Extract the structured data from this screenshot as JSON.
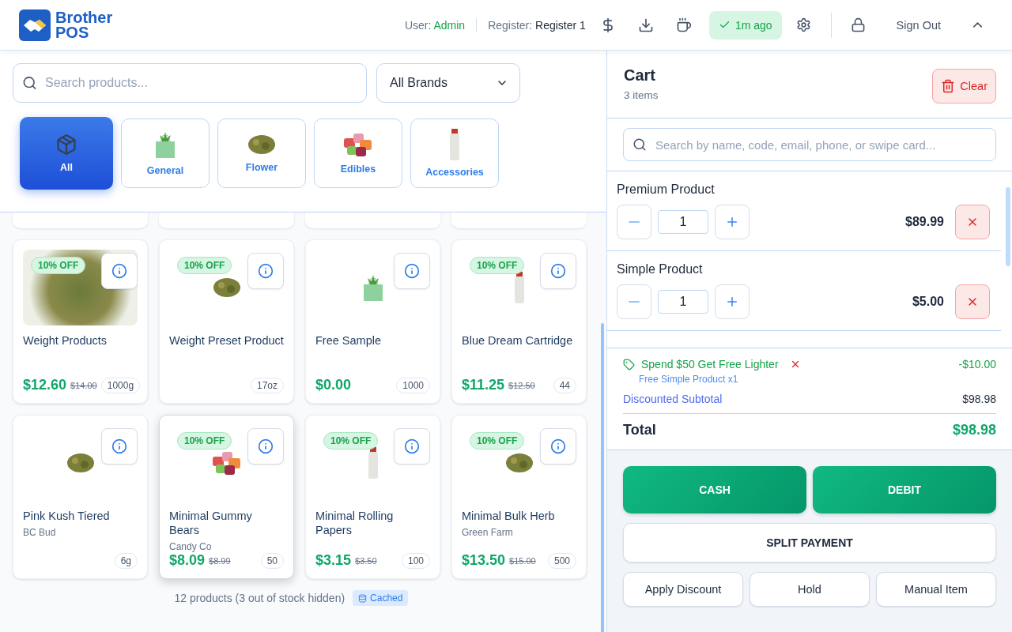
{
  "header": {
    "logo_line1": "Brother",
    "logo_line2": "POS",
    "user_label": "User:",
    "user": "Admin",
    "register_label": "Register:",
    "register": "Register 1",
    "sync_status": "1m ago",
    "sign_out": "Sign Out"
  },
  "search": {
    "placeholder": "Search products..."
  },
  "brand_select": {
    "value": "All Brands"
  },
  "categories": [
    {
      "label": "All",
      "selected": true,
      "kind": "box"
    },
    {
      "label": "General",
      "selected": false,
      "kind": "bag"
    },
    {
      "label": "Flower",
      "selected": false,
      "kind": "flower"
    },
    {
      "label": "Edibles",
      "selected": false,
      "kind": "gummies"
    },
    {
      "label": "Accessories",
      "selected": false,
      "kind": "lighter"
    }
  ],
  "products": [
    {
      "name": "Weight Products",
      "kind": "photo",
      "badge": "10% OFF",
      "price": "$12.60",
      "old_price": "$14.00",
      "stock": "1000g",
      "highlighted": false
    },
    {
      "name": "Weight Preset Product",
      "kind": "flower",
      "badge": "10% OFF",
      "stock": "17oz",
      "highlighted": false
    },
    {
      "name": "Free Sample",
      "kind": "bag",
      "price": "$0.00",
      "stock": "1000",
      "highlighted": false
    },
    {
      "name": "Blue Dream Cartridge",
      "kind": "lighter",
      "badge": "10% OFF",
      "price": "$11.25",
      "old_price": "$12.50",
      "stock": "44",
      "highlighted": false
    },
    {
      "name": "Pink Kush Tiered",
      "brand": "BC Bud",
      "kind": "flower",
      "stock": "6g",
      "highlighted": false
    },
    {
      "name": "Minimal Gummy Bears",
      "brand": "Candy Co",
      "kind": "gummies",
      "badge": "10% OFF",
      "price": "$8.09",
      "old_price": "$8.99",
      "stock": "50",
      "highlighted": true
    },
    {
      "name": "Minimal Rolling Papers",
      "kind": "lighter",
      "badge": "10% OFF",
      "price": "$3.15",
      "old_price": "$3.50",
      "stock": "100",
      "highlighted": false
    },
    {
      "name": "Minimal Bulk Herb",
      "brand": "Green Farm",
      "kind": "flower",
      "badge": "10% OFF",
      "price": "$13.50",
      "old_price": "$15.00",
      "stock": "500",
      "highlighted": false
    }
  ],
  "footer": {
    "count": "12 products (3 out of stock hidden)",
    "cache_badge": "Cached"
  },
  "cart": {
    "title": "Cart",
    "count": "3 items",
    "clear": "Clear",
    "search_placeholder": "Search by name, code, email, phone, or swipe card...",
    "items": [
      {
        "name": "Premium Product",
        "quantity": "1",
        "price": "$89.99"
      },
      {
        "name": "Simple Product",
        "quantity": "1",
        "price": "$5.00"
      }
    ],
    "promotion": {
      "name": "Spend $50 Get Free Lighter",
      "amount": "-$10.00",
      "detail": "Free Simple Product x1"
    },
    "subtotal_label": "Discounted Subtotal",
    "subtotal": "$98.98",
    "total_label": "Total",
    "total": "$98.98"
  },
  "payment": {
    "cash": "CASH",
    "debit": "DEBIT",
    "split": "SPLIT PAYMENT",
    "actions": [
      "Apply Discount",
      "Hold",
      "Manual Item"
    ]
  }
}
